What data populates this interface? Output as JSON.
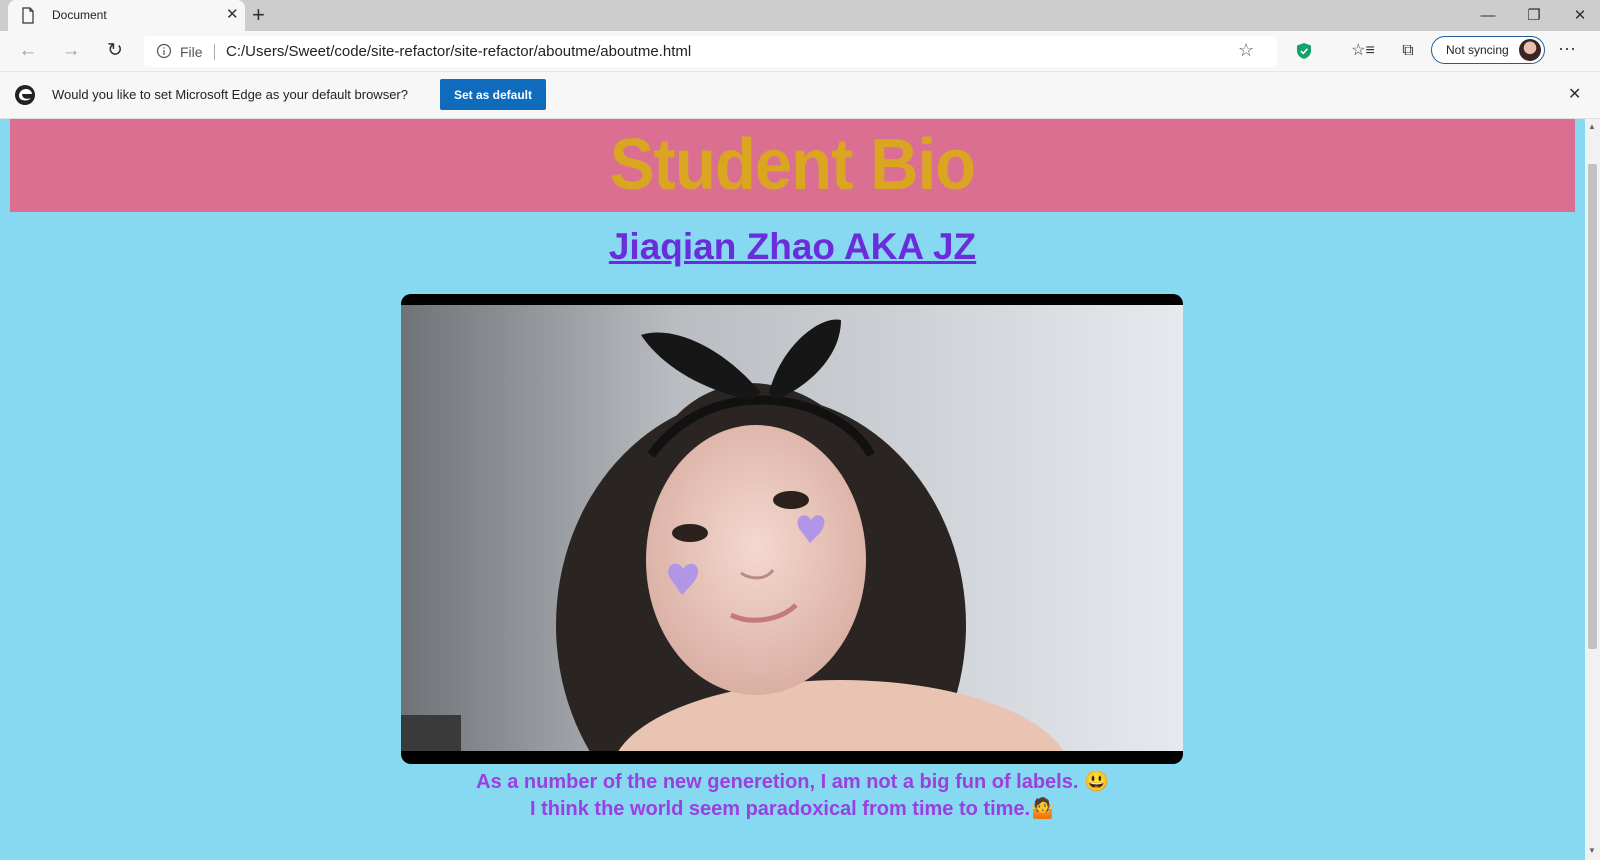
{
  "browser": {
    "tab_title": "Document",
    "tab_close": "✕",
    "new_tab": "+",
    "window_controls": {
      "minimize": "—",
      "restore": "❐",
      "close": "✕"
    },
    "nav": {
      "back": "←",
      "forward": "→",
      "refresh": "↻"
    },
    "address": {
      "scheme_label": "File",
      "url": "C:/Users/Sweet/code/site-refactor/site-refactor/aboutme/aboutme.html"
    },
    "sync_label": "Not syncing",
    "more": "···",
    "icons": [
      "page-icon",
      "info-icon",
      "star-icon",
      "shield-icon",
      "favorites-icon",
      "collections-icon",
      "profile-avatar",
      "more-icon"
    ]
  },
  "infobar": {
    "message": "Would you like to set Microsoft Edge as your default browser?",
    "button_label": "Set as default",
    "close": "✕"
  },
  "page": {
    "banner_title": "Student Bio",
    "name_link": "Jiaqian Zhao AKA JZ",
    "bio_lines": [
      "As a number of the new generetion, I am not a big fun of labels. 😃",
      "I think the world seem paradoxical from time to time.🤷"
    ]
  },
  "colors": {
    "page_bg": "#87d8f1",
    "banner_bg": "#db6f91",
    "banner_text": "#daa520",
    "link": "#6a2ddb",
    "bio_text": "#9a40e0",
    "button_blue": "#0f6cbd"
  }
}
